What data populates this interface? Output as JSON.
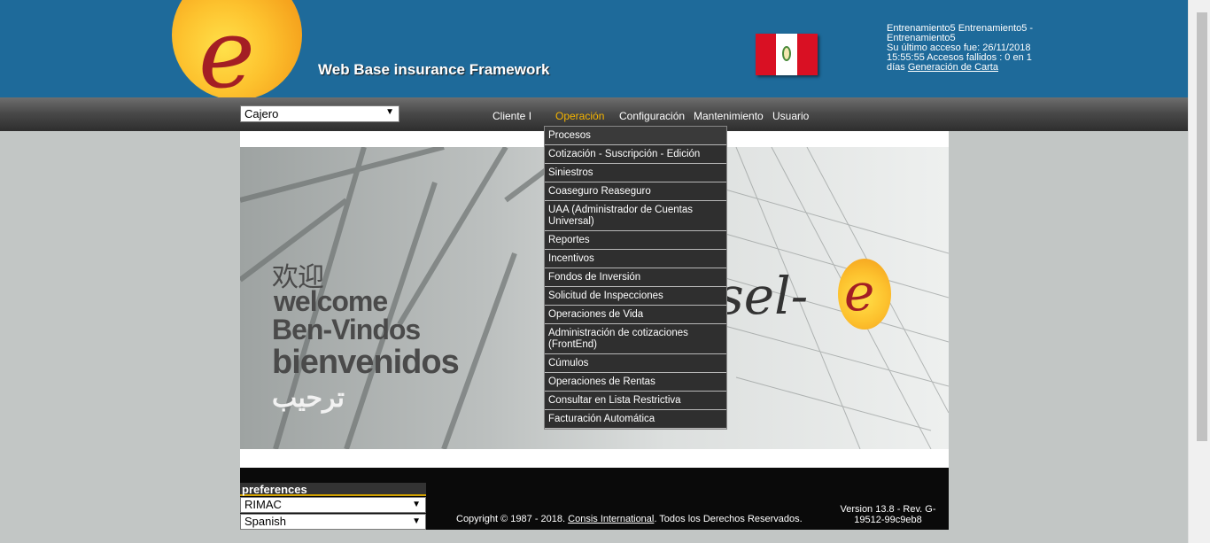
{
  "header": {
    "brand": "Web Base insurance Framework",
    "logo_letter": "e",
    "flag": "peru-flag",
    "user": {
      "name_line": "Entrenamiento5 Entrenamiento5 - Entrenamiento5",
      "last_access": "Su último acceso fue: 26/11/2018 15:55:55 Accesos fallidos : 0 en 1 días",
      "link": "Generación de Carta"
    }
  },
  "menubar": {
    "role": "Cajero",
    "items": [
      "Cliente I",
      "Operación",
      "Configuración",
      "Mantenimiento",
      "Usuario"
    ],
    "active": "Operación"
  },
  "dropdown": {
    "items": [
      "Procesos",
      "Cotización - Suscripción - Edición",
      "Siniestros",
      "Coaseguro Reaseguro",
      "UAA (Administrador de Cuentas Universal)",
      "Reportes",
      "Incentivos",
      "Fondos de Inversión",
      "Solicitud de Inspecciones",
      "Operaciones de Vida",
      "Administración de cotizaciones (FrontEnd)",
      "Cúmulos",
      "Operaciones de Rentas",
      "Consultar en Lista Restrictiva",
      "Facturación Automática"
    ]
  },
  "banner": {
    "line1": "欢迎",
    "line2": "welcome",
    "line3": "Ben-Vindos",
    "line4": "bienvenidos",
    "line5": "ترحيب",
    "logo_text": "sel-",
    "logo_e": "e"
  },
  "footer": {
    "preferences_title": "preferences",
    "company": "RIMAC",
    "language": "Spanish",
    "copyright_prefix": "Copyright © 1987 - 2018.",
    "copyright_link": "Consis International",
    "copyright_suffix": ". Todos los Derechos Reservados.",
    "version": "Version 13.8 - Rev. G-19512-99c9eb8"
  }
}
